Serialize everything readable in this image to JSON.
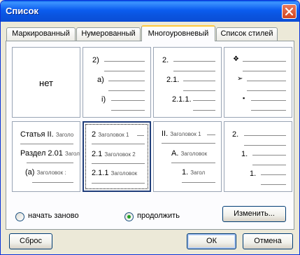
{
  "window": {
    "title": "Список"
  },
  "tabs": [
    {
      "label": "Маркированный"
    },
    {
      "label": "Нумерованный"
    },
    {
      "label": "Многоуровневый"
    },
    {
      "label": "Список стилей"
    }
  ],
  "active_tab": "Многоуровневый",
  "gallery": {
    "none_label": "нет",
    "cell2": {
      "l1": "2)",
      "l2": "a)",
      "l3": "i)"
    },
    "cell3": {
      "l1": "2.",
      "l2": "2.1.",
      "l3": "2.1.1."
    },
    "cell4": {
      "l1": "❖",
      "l2": "➢",
      "l3": "▪"
    },
    "cell5": {
      "l1_num": "Статья II.",
      "l1_text": "Заголо",
      "l2_num": "Раздел 2.01",
      "l2_text": "Загол",
      "l3_num": "(a)",
      "l3_text": "Заголовок :"
    },
    "cell6": {
      "l1_num": "2",
      "l1_text": "Заголовок 1",
      "l2_num": "2.1",
      "l2_text": "Заголовок 2",
      "l3_num": "2.1.1",
      "l3_text": "Заголовок"
    },
    "cell7": {
      "l1_num": "II.",
      "l1_text": "Заголовок 1",
      "l2_num": "A.",
      "l2_text": "Заголовок",
      "l3_num": "1.",
      "l3_text": "Загол"
    },
    "cell8": {
      "l1": "2.",
      "l2": "1.",
      "l3": "1."
    }
  },
  "options": {
    "restart_label": "начать заново",
    "continue_label": "продолжить",
    "selected": "продолжить"
  },
  "buttons": {
    "modify": "Изменить...",
    "reset": "Сброс",
    "ok": "ОК",
    "cancel": "Отмена"
  }
}
